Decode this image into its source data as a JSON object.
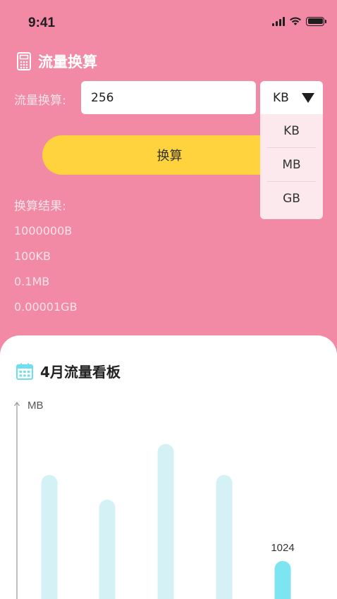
{
  "status_bar": {
    "time": "9:41"
  },
  "converter": {
    "title": "流量换算",
    "input_label": "流量换算:",
    "input_value": "256",
    "selected_unit": "KB",
    "unit_options": [
      "KB",
      "MB",
      "GB"
    ],
    "convert_button": "换算",
    "result_label": "换算结果:",
    "results": [
      "1000000B",
      "100KB",
      "0.1MB",
      "0.00001GB"
    ]
  },
  "dashboard": {
    "title": "4月流量看板",
    "chart_data": {
      "type": "bar",
      "ylabel": "MB",
      "series": [
        {
          "values": [
            null,
            null,
            null,
            null,
            1024
          ]
        }
      ],
      "data_labels": [
        "",
        "",
        "",
        "",
        "1024"
      ],
      "highlight_index": 4,
      "colors": {
        "bar": "#d4f1f6",
        "highlight": "#7de4f2",
        "axis": "#999999"
      }
    }
  },
  "colors": {
    "background": "#f28aa6",
    "button": "#fed33d",
    "card": "#ffffff"
  }
}
